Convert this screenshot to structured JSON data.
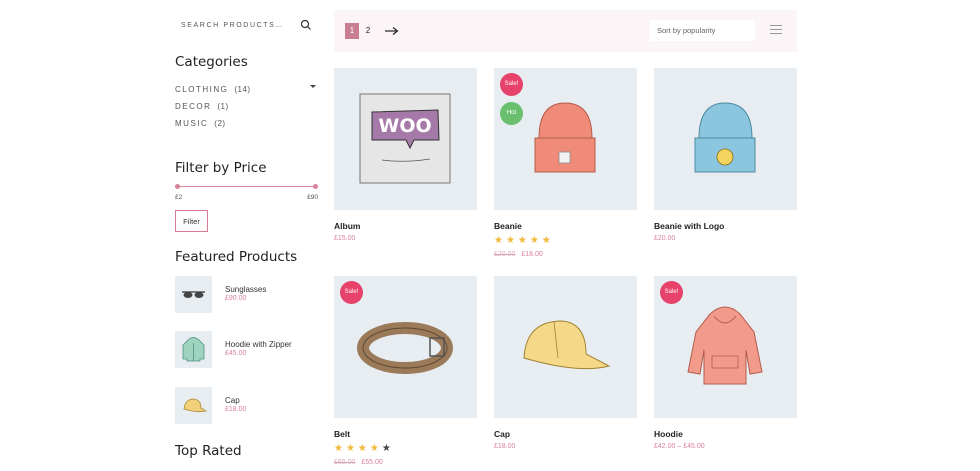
{
  "sidebar": {
    "search_placeholder": "SEARCH PRODUCTS…",
    "categories_title": "Categories",
    "categories": [
      {
        "label": "CLOTHING",
        "count": "(14)"
      },
      {
        "label": "DECOR",
        "count": "(1)"
      },
      {
        "label": "MUSIC",
        "count": "(2)"
      }
    ],
    "filter_title": "Filter by Price",
    "price_min": "£2",
    "price_max": "£90",
    "filter_button": "Filter",
    "featured_title": "Featured Products",
    "featured": [
      {
        "name": "Sunglasses",
        "price": "£90.00",
        "icon": "sunglasses-icon"
      },
      {
        "name": "Hoodie with Zipper",
        "price": "£45.00",
        "icon": "hoodie-icon"
      },
      {
        "name": "Cap",
        "price": "£18.00",
        "icon": "cap-icon"
      }
    ],
    "top_rated_title": "Top Rated"
  },
  "toolbar": {
    "pages": [
      "1",
      "2"
    ],
    "current_page": "1",
    "sort_label": "Sort by popularity"
  },
  "products": [
    {
      "name": "Album",
      "price": "£15.00",
      "old_price": "",
      "rating": 0,
      "badges": []
    },
    {
      "name": "Beanie",
      "price": "£18.00",
      "old_price": "£20.00",
      "rating": 5,
      "badges": [
        "Sale!",
        "Hot"
      ]
    },
    {
      "name": "Beanie with Logo",
      "price": "£20.00",
      "old_price": "",
      "rating": 0,
      "badges": []
    },
    {
      "name": "Belt",
      "price": "£55.00",
      "old_price": "£65.00",
      "rating": 4,
      "badges": [
        "Sale!"
      ]
    },
    {
      "name": "Cap",
      "price": "£18.00",
      "old_price": "",
      "rating": 0,
      "badges": []
    },
    {
      "name": "Hoodie",
      "price": "£42.00 – £45.00",
      "old_price": "",
      "rating": 0,
      "badges": [
        "Sale!"
      ]
    }
  ],
  "colors": {
    "accent": "#d9829a",
    "sale": "#e6426b",
    "hot": "#6ac06e",
    "image_bg": "#e7edf1"
  }
}
